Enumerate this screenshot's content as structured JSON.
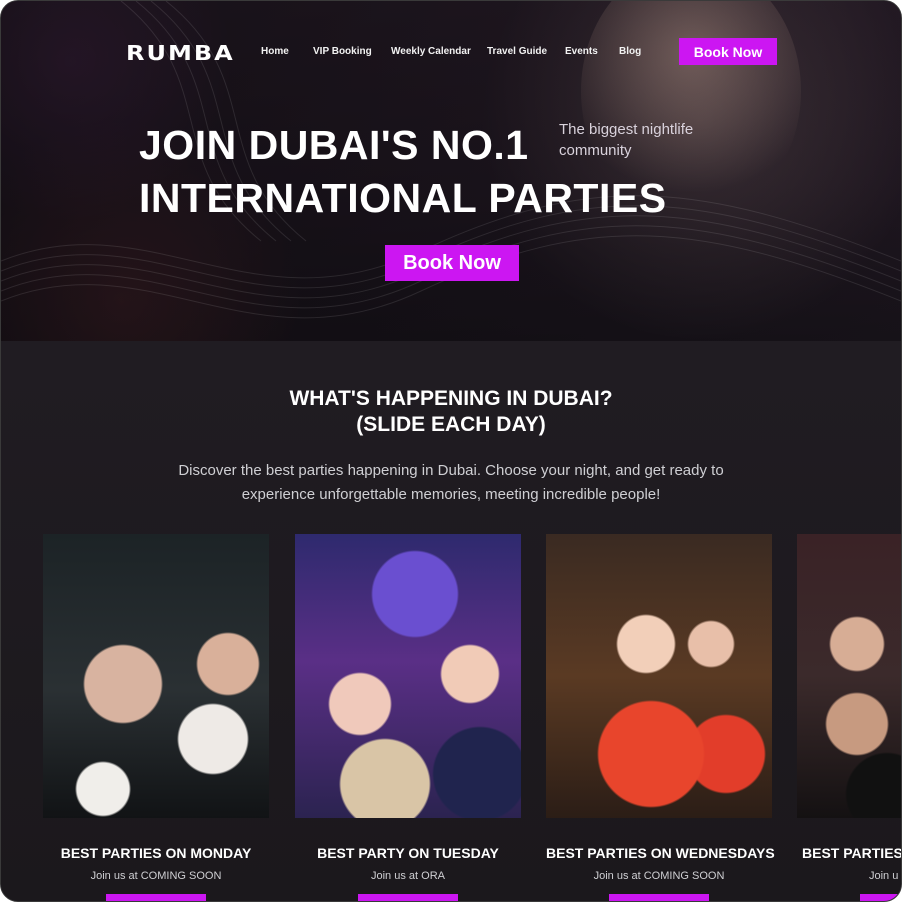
{
  "brand": {
    "logo": "RUMBA"
  },
  "nav": {
    "items": [
      "Home",
      "VIP Booking",
      "Weekly Calendar",
      "Travel Guide",
      "Events",
      "Blog"
    ],
    "cta": "Book Now"
  },
  "hero": {
    "title_line1": "JOIN DUBAI'S NO.1",
    "title_line2": "INTERNATIONAL PARTIES",
    "subtitle": "The biggest nightlife community",
    "cta": "Book Now"
  },
  "section": {
    "title_line1": "WHAT'S HAPPENING IN DUBAI?",
    "title_line2": "(SLIDE EACH DAY)",
    "description": "Discover the best parties happening in Dubai. Choose your night, and get ready to experience unforgettable memories, meeting incredible people!"
  },
  "cards": [
    {
      "title": "BEST PARTIES ON MONDAY",
      "subtitle": "Join us at COMING SOON"
    },
    {
      "title": "BEST PARTY ON TUESDAY",
      "subtitle": "Join us at ORA"
    },
    {
      "title": "BEST PARTIES ON WEDNESDAYS",
      "subtitle": "Join us at COMING SOON"
    },
    {
      "title": "BEST PARTIES",
      "subtitle": "Join u"
    }
  ],
  "colors": {
    "accent": "#cc16f2",
    "background": "#1b181c"
  }
}
